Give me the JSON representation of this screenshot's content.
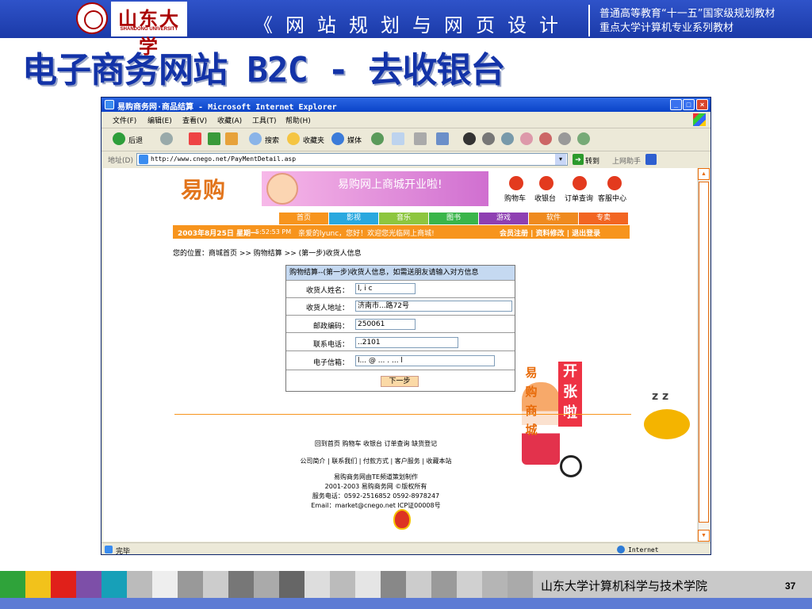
{
  "slide": {
    "logo": {
      "cn": "山东大学",
      "en": "SHANDONG UNIVERSITY"
    },
    "course_title": "《网站规划与网页设计》",
    "series": {
      "line1": "普通高等教育“十一五”国家级规划教材",
      "line2": "重点大学计算机专业系列教材"
    },
    "title": "电子商务网站 B2C - 去收银台",
    "footer_school": "山东大学计算机科学与技术学院",
    "page_number": "37",
    "brand_color": "#1333a8"
  },
  "browser": {
    "window_title": "易购商务网·商品结算 - Microsoft Internet Explorer",
    "window_buttons": [
      "_",
      "□",
      "×"
    ],
    "menu": [
      "文件(F)",
      "编辑(E)",
      "查看(V)",
      "收藏(A)",
      "工具(T)",
      "帮助(H)"
    ],
    "toolbar": {
      "back": "后退",
      "search": "搜索",
      "favorites": "收藏夹",
      "media": "媒体"
    },
    "address_label": "地址(D)",
    "address": "http://www.cnego.net/PayMentDetail.asp",
    "go": "转到",
    "assistant": "上网助手",
    "status": "完毕",
    "zone": "Internet"
  },
  "site": {
    "logo": "易购",
    "banner_text": "易购网上商城开业啦!",
    "nav": [
      "购物车",
      "收银台",
      "订单查询",
      "客服中心"
    ],
    "categories": [
      {
        "label": "首页",
        "color": "#f7941d"
      },
      {
        "label": "影视",
        "color": "#29a8df"
      },
      {
        "label": "音乐",
        "color": "#8dc63f"
      },
      {
        "label": "图书",
        "color": "#39b54a"
      },
      {
        "label": "游戏",
        "color": "#8e3fb2"
      },
      {
        "label": "软件",
        "color": "#ef8a1f"
      },
      {
        "label": "专卖",
        "color": "#f26522"
      }
    ],
    "date": "2003年8月25日 星期一",
    "time": "5:52:53 PM",
    "welcome": "亲爱的lyunc，您好！欢迎您光临网上商城!",
    "account_links": "会员注册 | 资料修改 | 退出登录",
    "breadcrumb": "您的位置：商城首页 >> 购物结算 >> (第一步)收货人信息",
    "form": {
      "header": "购物结算--(第一步)收货人信息，如需送朋友请输入对方信息",
      "fields": [
        {
          "label": "收货人姓名：",
          "value": "l, i c"
        },
        {
          "label": "收货人地址：",
          "value": "济南市...路72号"
        },
        {
          "label": "邮政编码：",
          "value": "250061"
        },
        {
          "label": "联系电话：",
          "value": "..2101"
        },
        {
          "label": "电子信箱：",
          "value": "l... @ ... . ... l"
        }
      ],
      "next_label": "下一步"
    },
    "shop_vertical": "易购商城",
    "opening_sign": "开张啦",
    "zz": "z z",
    "footer": {
      "links1": "回到首页 购物车 收银台 订单查询 缺货登记",
      "links2": "公司简介 | 联系我们 | 付款方式 | 客户服务 | 收藏本站",
      "credit": "易购商务网由TE频道策划制作",
      "copyright": "2001-2003 易购商务网 ©版权所有",
      "phone": "服务电话：0592-2516852 0592-8978247",
      "email": "Email：market@cnego.net ICP证00008号"
    }
  }
}
